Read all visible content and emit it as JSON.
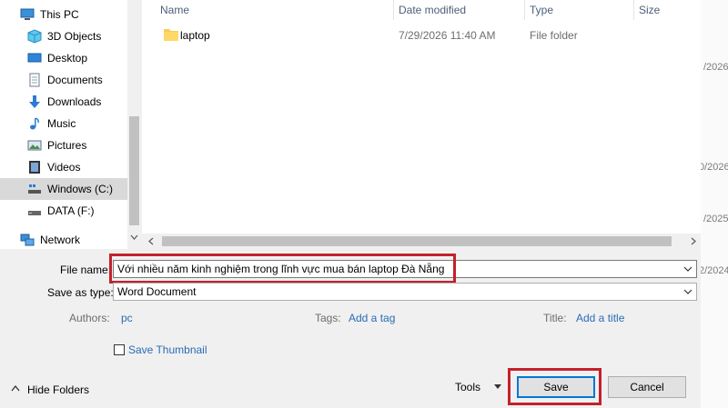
{
  "nav": {
    "items": [
      {
        "label": "This PC",
        "icon": "computer-icon"
      },
      {
        "label": "3D Objects",
        "icon": "cube-icon"
      },
      {
        "label": "Desktop",
        "icon": "desktop-icon"
      },
      {
        "label": "Documents",
        "icon": "document-icon"
      },
      {
        "label": "Downloads",
        "icon": "download-icon"
      },
      {
        "label": "Music",
        "icon": "music-icon"
      },
      {
        "label": "Pictures",
        "icon": "pictures-icon"
      },
      {
        "label": "Videos",
        "icon": "video-icon"
      },
      {
        "label": "Windows (C:)",
        "icon": "drive-icon",
        "selected": true
      },
      {
        "label": "DATA (F:)",
        "icon": "drive-icon"
      },
      {
        "label": "Network",
        "icon": "network-icon"
      }
    ]
  },
  "file_list": {
    "columns": [
      "Name",
      "Date modified",
      "Type",
      "Size"
    ],
    "rows": [
      {
        "name": "laptop",
        "date": "7/29/2026 11:40 AM",
        "type": "File folder",
        "size": ""
      }
    ]
  },
  "form": {
    "file_name_label": "File name:",
    "file_name_value": "Với nhiều năm kinh nghiệm trong lĩnh vực mua bán laptop Đà Nẵng",
    "save_type_label": "Save as type:",
    "save_type_value": "Word Document",
    "authors_label": "Authors:",
    "authors_value": "pc",
    "tags_label": "Tags:",
    "tags_value": "Add a tag",
    "title_label": "Title:",
    "title_value": "Add a title",
    "thumbnail_label": "Save Thumbnail"
  },
  "footer": {
    "hide_folders": "Hide Folders",
    "tools": "Tools",
    "save": "Save",
    "cancel": "Cancel"
  },
  "background_strip": [
    "/2026",
    "0/2026",
    "/2025",
    "2/2024"
  ],
  "colors": {
    "highlight": "#c4212b",
    "link": "#2a6cb5",
    "selection": "#d9d9d9"
  }
}
